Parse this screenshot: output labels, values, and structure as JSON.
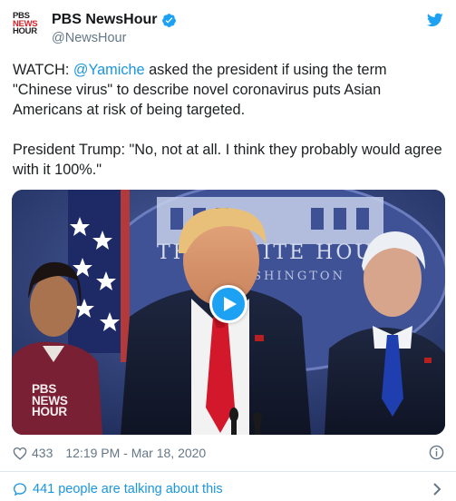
{
  "account": {
    "display_name": "PBS NewsHour",
    "handle": "@NewsHour",
    "avatar_text": [
      "PBS",
      "NEWS",
      "HOUR"
    ],
    "verified": true
  },
  "tweet": {
    "line1_prefix": "WATCH: ",
    "mention": "@Yamiche",
    "line1_suffix": " asked the president if using the term \"Chinese virus\" to describe novel coronavirus puts Asian Americans at risk of being targeted.",
    "line2": "President Trump: \"No, not at all. I think they probably would agree with it 100%.\""
  },
  "media": {
    "type": "video",
    "backdrop_text_line1": "THE WHITE HOUSE",
    "backdrop_text_line2": "WASHINGTON",
    "watermark": [
      "PBS",
      "NEWS",
      "HOUR"
    ],
    "play_icon": "play-icon"
  },
  "meta": {
    "like_count": "433",
    "timestamp": "12:19 PM - Mar 18, 2020"
  },
  "footer": {
    "talking_text": "441 people are talking about this"
  },
  "colors": {
    "link": "#1b95e0",
    "secondary_text": "#657786",
    "verified": "#1da1f2",
    "twitter_brand": "#1da1f2",
    "pbs_red": "#d4232a"
  },
  "icons": [
    "verified-icon",
    "twitter-icon",
    "heart-icon",
    "info-icon",
    "bubble-icon",
    "chevron-right-icon",
    "play-icon"
  ]
}
